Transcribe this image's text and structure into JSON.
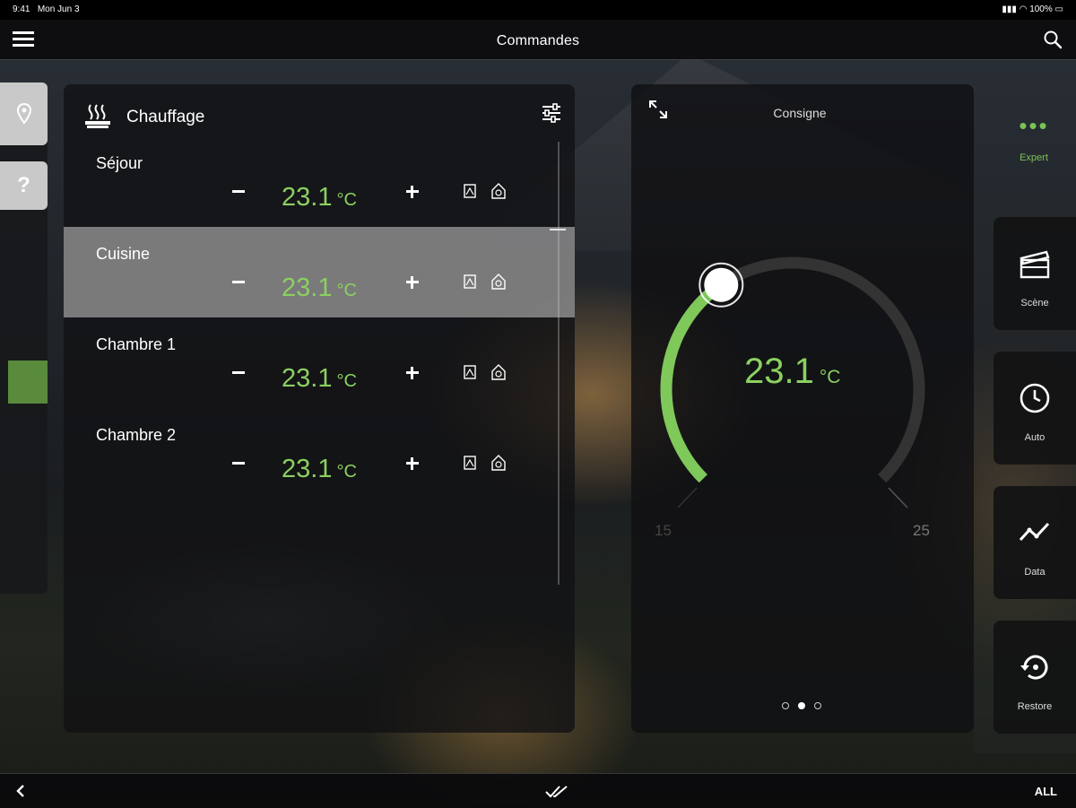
{
  "status": {
    "time": "9:41",
    "date": "Mon Jun 3",
    "battery": "100%"
  },
  "header": {
    "title": "Commandes"
  },
  "heating": {
    "title": "Chauffage",
    "rooms": [
      {
        "name": "Séjour",
        "temp": "23.1",
        "unit": "°C"
      },
      {
        "name": "Cuisine",
        "temp": "23.1",
        "unit": "°C"
      },
      {
        "name": "Chambre 1",
        "temp": "23.1",
        "unit": "°C"
      },
      {
        "name": "Chambre 2",
        "temp": "23.1",
        "unit": "°C"
      }
    ]
  },
  "consigne": {
    "title": "Consigne",
    "value": "23.1",
    "unit": "°C",
    "min": "15",
    "max": "25",
    "page": 2,
    "pages": 3
  },
  "modes": {
    "expert_label": "Expert",
    "items": [
      {
        "label": "Scène",
        "icon": "clapperboard-icon"
      },
      {
        "label": "Auto",
        "icon": "clock-icon"
      },
      {
        "label": "Data",
        "icon": "chart-line-icon"
      },
      {
        "label": "Restore",
        "icon": "restore-icon"
      }
    ]
  },
  "footer": {
    "all_label": "ALL"
  },
  "colors": {
    "accent": "#8bd160",
    "accent_dark": "#5a8a3c"
  }
}
